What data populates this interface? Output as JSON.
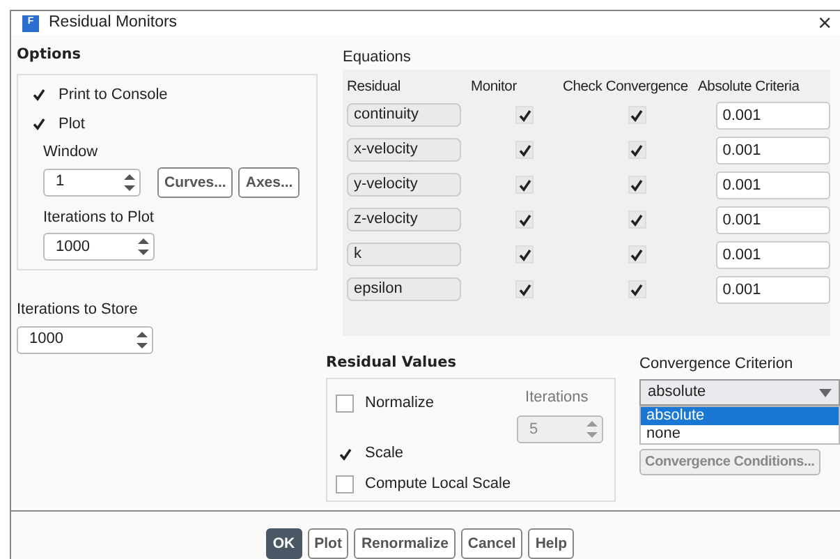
{
  "window": {
    "title": "Residual Monitors",
    "app_icon_letter": "F",
    "close": "×"
  },
  "options": {
    "title": "Options",
    "print_to_console": {
      "label": "Print to Console",
      "checked": true
    },
    "plot": {
      "label": "Plot",
      "checked": true
    },
    "window_label": "Window",
    "window_value": "1",
    "curves_button": "Curves...",
    "axes_button": "Axes...",
    "iterations_to_plot_label": "Iterations to Plot",
    "iterations_to_plot": "1000"
  },
  "iterations_to_store": {
    "label": "Iterations to Store",
    "value": "1000"
  },
  "equations": {
    "title": "Equations",
    "columns": [
      "Residual",
      "Monitor",
      "Check Convergence",
      "Absolute Criteria"
    ],
    "rows": [
      {
        "residual": "continuity",
        "monitor": true,
        "check_convergence": true,
        "absolute_criteria": "0.001"
      },
      {
        "residual": "x-velocity",
        "monitor": true,
        "check_convergence": true,
        "absolute_criteria": "0.001"
      },
      {
        "residual": "y-velocity",
        "monitor": true,
        "check_convergence": true,
        "absolute_criteria": "0.001"
      },
      {
        "residual": "z-velocity",
        "monitor": true,
        "check_convergence": true,
        "absolute_criteria": "0.001"
      },
      {
        "residual": "k",
        "monitor": true,
        "check_convergence": true,
        "absolute_criteria": "0.001"
      },
      {
        "residual": "epsilon",
        "monitor": true,
        "check_convergence": true,
        "absolute_criteria": "0.001"
      }
    ]
  },
  "residual_values": {
    "title": "Residual Values",
    "options": [
      {
        "label": "Normalize",
        "checked": false
      },
      {
        "label": "Scale",
        "checked": true
      },
      {
        "label": "Compute Local Scale",
        "checked": false
      }
    ],
    "iterations": {
      "label": "Iterations",
      "value": "5",
      "disabled": true
    }
  },
  "convergence_criterion": {
    "label": "Convergence Criterion",
    "value": "absolute",
    "dropdown_items": [
      {
        "label": "absolute",
        "selected": true
      },
      {
        "label": "none",
        "selected": false
      }
    ],
    "conditions_button": {
      "label": "Convergence Conditions...",
      "disabled": true
    }
  },
  "buttons": [
    {
      "label": "OK",
      "primary": true
    },
    {
      "label": "Plot",
      "primary": false
    },
    {
      "label": "Renormalize",
      "primary": false
    },
    {
      "label": "Cancel",
      "primary": false
    },
    {
      "label": "Help",
      "primary": false
    }
  ]
}
